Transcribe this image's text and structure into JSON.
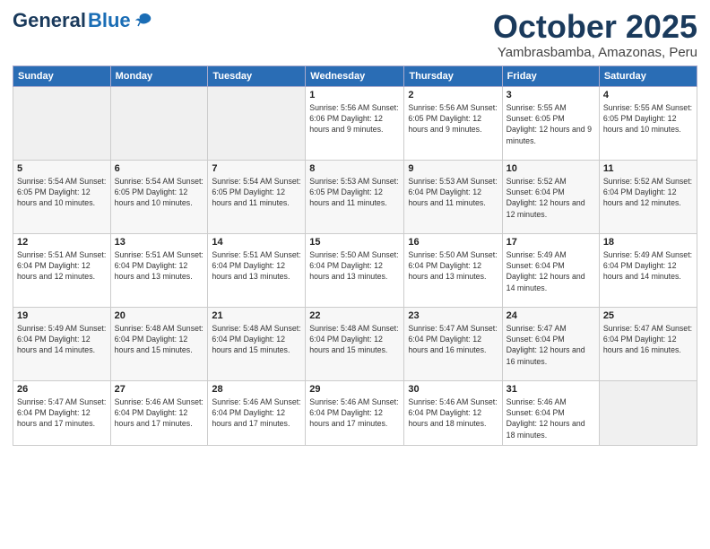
{
  "header": {
    "logo_general": "General",
    "logo_blue": "Blue",
    "month": "October 2025",
    "location": "Yambrasbamba, Amazonas, Peru"
  },
  "days_of_week": [
    "Sunday",
    "Monday",
    "Tuesday",
    "Wednesday",
    "Thursday",
    "Friday",
    "Saturday"
  ],
  "weeks": [
    {
      "row_class": "row-light",
      "days": [
        {
          "num": "",
          "empty": true
        },
        {
          "num": "",
          "empty": true
        },
        {
          "num": "",
          "empty": true
        },
        {
          "num": "1",
          "info": "Sunrise: 5:56 AM\nSunset: 6:06 PM\nDaylight: 12 hours\nand 9 minutes."
        },
        {
          "num": "2",
          "info": "Sunrise: 5:56 AM\nSunset: 6:05 PM\nDaylight: 12 hours\nand 9 minutes."
        },
        {
          "num": "3",
          "info": "Sunrise: 5:55 AM\nSunset: 6:05 PM\nDaylight: 12 hours\nand 9 minutes."
        },
        {
          "num": "4",
          "info": "Sunrise: 5:55 AM\nSunset: 6:05 PM\nDaylight: 12 hours\nand 10 minutes."
        }
      ]
    },
    {
      "row_class": "row-alt",
      "days": [
        {
          "num": "5",
          "info": "Sunrise: 5:54 AM\nSunset: 6:05 PM\nDaylight: 12 hours\nand 10 minutes."
        },
        {
          "num": "6",
          "info": "Sunrise: 5:54 AM\nSunset: 6:05 PM\nDaylight: 12 hours\nand 10 minutes."
        },
        {
          "num": "7",
          "info": "Sunrise: 5:54 AM\nSunset: 6:05 PM\nDaylight: 12 hours\nand 11 minutes."
        },
        {
          "num": "8",
          "info": "Sunrise: 5:53 AM\nSunset: 6:05 PM\nDaylight: 12 hours\nand 11 minutes."
        },
        {
          "num": "9",
          "info": "Sunrise: 5:53 AM\nSunset: 6:04 PM\nDaylight: 12 hours\nand 11 minutes."
        },
        {
          "num": "10",
          "info": "Sunrise: 5:52 AM\nSunset: 6:04 PM\nDaylight: 12 hours\nand 12 minutes."
        },
        {
          "num": "11",
          "info": "Sunrise: 5:52 AM\nSunset: 6:04 PM\nDaylight: 12 hours\nand 12 minutes."
        }
      ]
    },
    {
      "row_class": "row-light",
      "days": [
        {
          "num": "12",
          "info": "Sunrise: 5:51 AM\nSunset: 6:04 PM\nDaylight: 12 hours\nand 12 minutes."
        },
        {
          "num": "13",
          "info": "Sunrise: 5:51 AM\nSunset: 6:04 PM\nDaylight: 12 hours\nand 13 minutes."
        },
        {
          "num": "14",
          "info": "Sunrise: 5:51 AM\nSunset: 6:04 PM\nDaylight: 12 hours\nand 13 minutes."
        },
        {
          "num": "15",
          "info": "Sunrise: 5:50 AM\nSunset: 6:04 PM\nDaylight: 12 hours\nand 13 minutes."
        },
        {
          "num": "16",
          "info": "Sunrise: 5:50 AM\nSunset: 6:04 PM\nDaylight: 12 hours\nand 13 minutes."
        },
        {
          "num": "17",
          "info": "Sunrise: 5:49 AM\nSunset: 6:04 PM\nDaylight: 12 hours\nand 14 minutes."
        },
        {
          "num": "18",
          "info": "Sunrise: 5:49 AM\nSunset: 6:04 PM\nDaylight: 12 hours\nand 14 minutes."
        }
      ]
    },
    {
      "row_class": "row-alt",
      "days": [
        {
          "num": "19",
          "info": "Sunrise: 5:49 AM\nSunset: 6:04 PM\nDaylight: 12 hours\nand 14 minutes."
        },
        {
          "num": "20",
          "info": "Sunrise: 5:48 AM\nSunset: 6:04 PM\nDaylight: 12 hours\nand 15 minutes."
        },
        {
          "num": "21",
          "info": "Sunrise: 5:48 AM\nSunset: 6:04 PM\nDaylight: 12 hours\nand 15 minutes."
        },
        {
          "num": "22",
          "info": "Sunrise: 5:48 AM\nSunset: 6:04 PM\nDaylight: 12 hours\nand 15 minutes."
        },
        {
          "num": "23",
          "info": "Sunrise: 5:47 AM\nSunset: 6:04 PM\nDaylight: 12 hours\nand 16 minutes."
        },
        {
          "num": "24",
          "info": "Sunrise: 5:47 AM\nSunset: 6:04 PM\nDaylight: 12 hours\nand 16 minutes."
        },
        {
          "num": "25",
          "info": "Sunrise: 5:47 AM\nSunset: 6:04 PM\nDaylight: 12 hours\nand 16 minutes."
        }
      ]
    },
    {
      "row_class": "row-light",
      "days": [
        {
          "num": "26",
          "info": "Sunrise: 5:47 AM\nSunset: 6:04 PM\nDaylight: 12 hours\nand 17 minutes."
        },
        {
          "num": "27",
          "info": "Sunrise: 5:46 AM\nSunset: 6:04 PM\nDaylight: 12 hours\nand 17 minutes."
        },
        {
          "num": "28",
          "info": "Sunrise: 5:46 AM\nSunset: 6:04 PM\nDaylight: 12 hours\nand 17 minutes."
        },
        {
          "num": "29",
          "info": "Sunrise: 5:46 AM\nSunset: 6:04 PM\nDaylight: 12 hours\nand 17 minutes."
        },
        {
          "num": "30",
          "info": "Sunrise: 5:46 AM\nSunset: 6:04 PM\nDaylight: 12 hours\nand 18 minutes."
        },
        {
          "num": "31",
          "info": "Sunrise: 5:46 AM\nSunset: 6:04 PM\nDaylight: 12 hours\nand 18 minutes."
        },
        {
          "num": "",
          "empty": true
        }
      ]
    }
  ]
}
